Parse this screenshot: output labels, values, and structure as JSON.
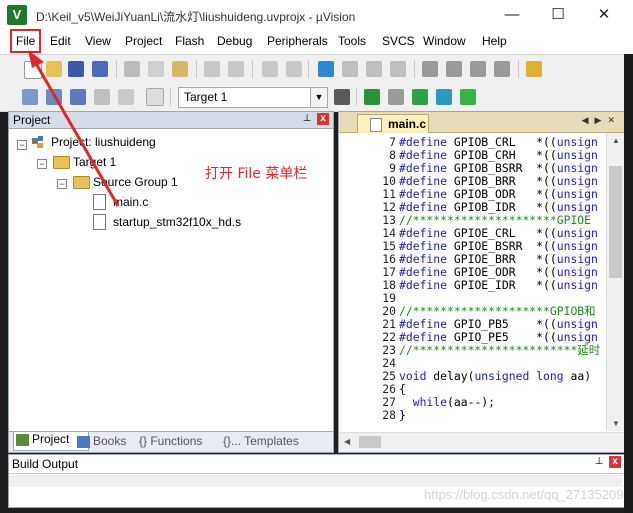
{
  "window": {
    "title": "D:\\Keil_v5\\WeiJiYuanLi\\流水灯\\liushuideng.uvprojx - µVision",
    "app_icon": "V",
    "minimize_glyph": "—",
    "maximize_glyph": "☐",
    "close_glyph": "✕"
  },
  "menubar": {
    "items": [
      "File",
      "Edit",
      "View",
      "Project",
      "Flash",
      "Debug",
      "Peripherals",
      "Tools",
      "SVCS",
      "Window",
      "Help"
    ]
  },
  "toolbar2": {
    "target_value": "Target 1"
  },
  "project_panel": {
    "title": "Project",
    "pin_glyph": "⊥",
    "close_glyph": "x",
    "tree": {
      "project": "Project: liushuideng",
      "target": "Target 1",
      "group": "Source Group 1",
      "files": [
        "main.c",
        "startup_stm32f10x_hd.s"
      ]
    },
    "tabs": [
      "Project",
      "Books",
      "{} Functions",
      "{}... Templates"
    ]
  },
  "editor": {
    "tab_label": "main.c",
    "lines": [
      {
        "n": "7",
        "kw": "#define",
        "rest": " GPIOB_CRL   *((",
        "tail": "unsign"
      },
      {
        "n": "8",
        "kw": "#define",
        "rest": " GPIOB_CRH   *((",
        "tail": "unsign"
      },
      {
        "n": "9",
        "kw": "#define",
        "rest": " GPIOB_BSRR  *((",
        "tail": "unsign"
      },
      {
        "n": "10",
        "kw": "#define",
        "rest": " GPIOB_BRR   *((",
        "tail": "unsign"
      },
      {
        "n": "11",
        "kw": "#define",
        "rest": " GPIOB_ODR   *((",
        "tail": "unsign"
      },
      {
        "n": "12",
        "kw": "#define",
        "rest": " GPIOB_IDR   *((",
        "tail": "unsign"
      },
      {
        "n": "13",
        "comment": "//*********************GPIOE"
      },
      {
        "n": "14",
        "kw": "#define",
        "rest": " GPIOE_CRL   *((",
        "tail": "unsign"
      },
      {
        "n": "15",
        "kw": "#define",
        "rest": " GPIOE_BSRR  *((",
        "tail": "unsign"
      },
      {
        "n": "16",
        "kw": "#define",
        "rest": " GPIOE_BRR   *((",
        "tail": "unsign"
      },
      {
        "n": "17",
        "kw": "#define",
        "rest": " GPIOE_ODR   *((",
        "tail": "unsign"
      },
      {
        "n": "18",
        "kw": "#define",
        "rest": " GPIOE_IDR   *((",
        "tail": "unsign"
      },
      {
        "n": "19",
        "plain": ""
      },
      {
        "n": "20",
        "comment": "//********************GPIOB和"
      },
      {
        "n": "21",
        "kw": "#define",
        "rest": " GPIO_PB5    *((",
        "tail": "unsign"
      },
      {
        "n": "22",
        "kw": "#define",
        "rest": " GPIO_PE5    *((",
        "tail": "unsign"
      },
      {
        "n": "23",
        "comment": "//************************延时"
      },
      {
        "n": "24",
        "plain": ""
      },
      {
        "n": "25",
        "code": "void delay(unsigned long aa)"
      },
      {
        "n": "26",
        "plain": "{"
      },
      {
        "n": "27",
        "code": "  while(aa--);"
      },
      {
        "n": "28",
        "plain": "}"
      }
    ]
  },
  "build_output": {
    "title": "Build Output"
  },
  "annotation": {
    "text": "打开 File 菜单栏",
    "color": "#e3262b"
  },
  "watermark": "https://blog.csdn.net/qq_27135209",
  "colors": {
    "keyword": "#1d1dbf",
    "comment": "#1e8a1e",
    "panel_header": "#d6dbe9",
    "editor_tab": "#fdf0bd"
  }
}
